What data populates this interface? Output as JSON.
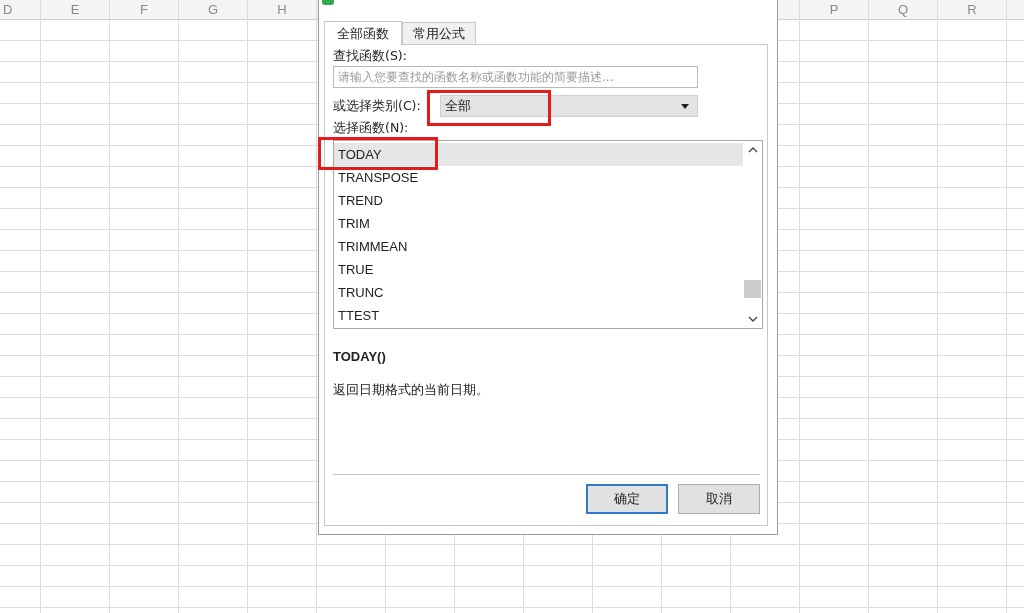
{
  "sheet": {
    "columns_left": [
      "D",
      "E",
      "F",
      "G",
      "H"
    ],
    "columns_right": [
      "P",
      "Q",
      "R"
    ]
  },
  "dialog": {
    "tabs": [
      {
        "label": "全部函数",
        "selected": true
      },
      {
        "label": "常用公式",
        "selected": false
      }
    ],
    "search": {
      "label": "查找函数(S):",
      "placeholder": "请输入您要查找的函数名称或函数功能的简要描述..."
    },
    "category": {
      "label": "或选择类别(C):",
      "value": "全部"
    },
    "functions": {
      "label": "选择函数(N):",
      "items": [
        {
          "name": "TODAY",
          "selected": true
        },
        {
          "name": "TRANSPOSE",
          "selected": false
        },
        {
          "name": "TREND",
          "selected": false
        },
        {
          "name": "TRIM",
          "selected": false
        },
        {
          "name": "TRIMMEAN",
          "selected": false
        },
        {
          "name": "TRUE",
          "selected": false
        },
        {
          "name": "TRUNC",
          "selected": false
        },
        {
          "name": "TTEST",
          "selected": false
        }
      ]
    },
    "signature": "TODAY()",
    "description": "返回日期格式的当前日期。",
    "buttons": [
      {
        "label": "确定",
        "kind": "primary"
      },
      {
        "label": "取消",
        "kind": "secondary"
      }
    ]
  }
}
